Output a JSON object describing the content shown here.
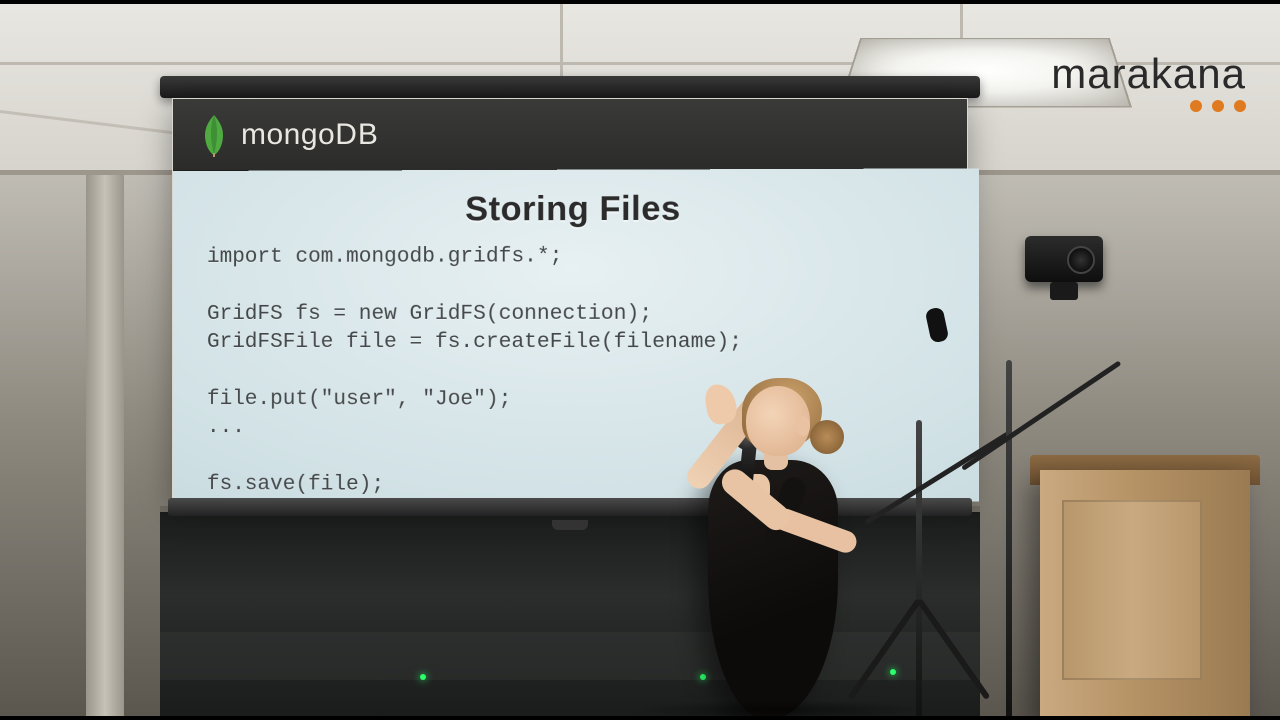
{
  "watermark": {
    "text": "marakana"
  },
  "slide": {
    "brand_primary": "mongo",
    "brand_secondary": "DB",
    "title": "Storing Files",
    "code": "import com.mongodb.gridfs.*;\n\nGridFS fs = new GridFS(connection);\nGridFSFile file = fs.createFile(filename);\n\nfile.put(\"user\", \"Joe\");\n...\n\nfs.save(file);"
  },
  "icons": {
    "leaf": "mongodb-leaf-icon"
  },
  "colors": {
    "accent_orange": "#e07a1f",
    "mongo_green": "#4faa41",
    "mongo_green_dark": "#3f8f35"
  }
}
